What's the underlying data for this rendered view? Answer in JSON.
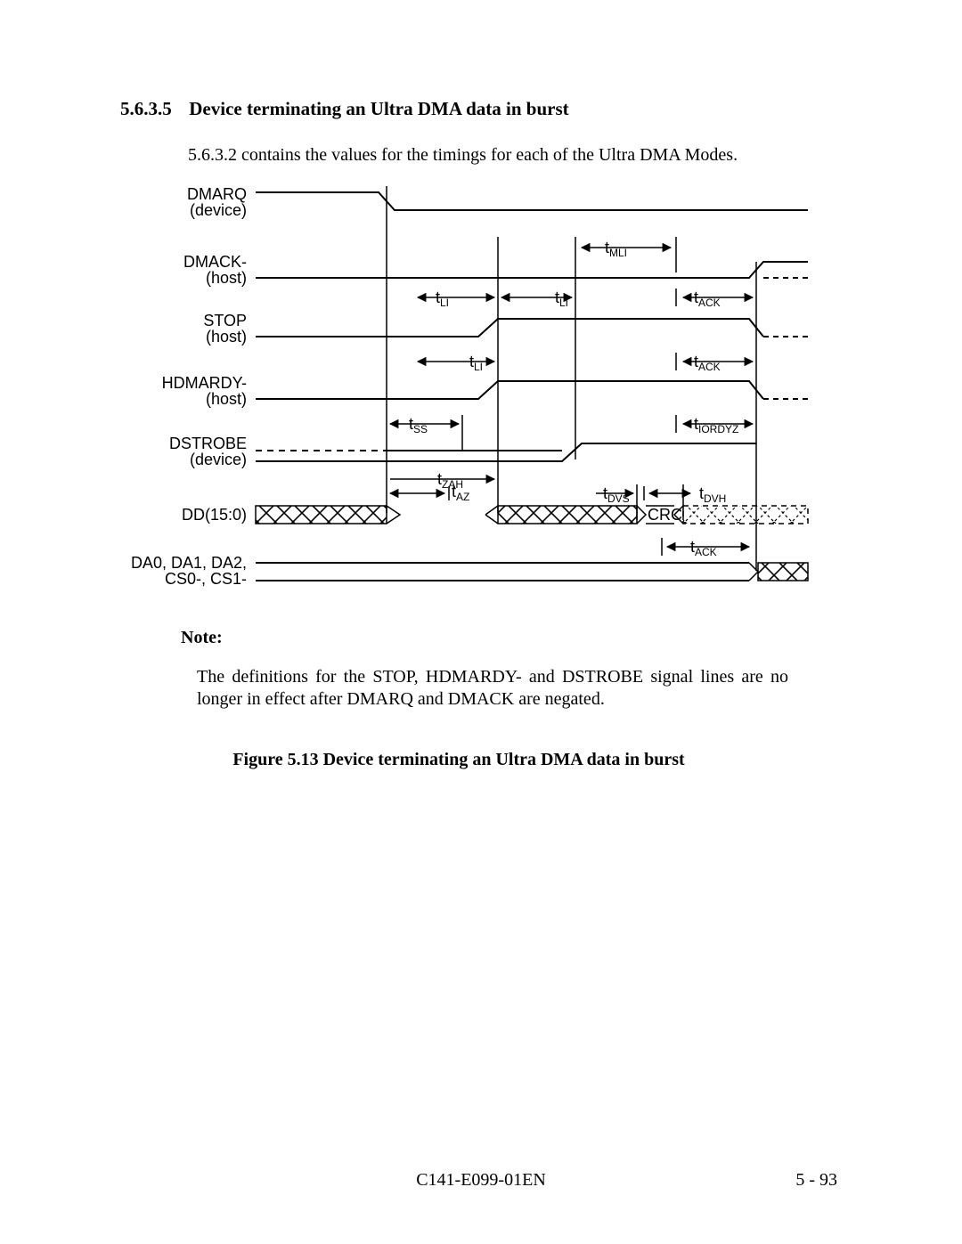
{
  "heading": {
    "number": "5.6.3.5",
    "title": "Device terminating an Ultra DMA data in burst"
  },
  "para1": "5.6.3.2 contains the values for the timings for each of the Ultra DMA Modes.",
  "signals": {
    "dmarq": {
      "name": "DMARQ",
      "role": "(device)"
    },
    "dmack": {
      "name": "DMACK-",
      "role": "(host)"
    },
    "stop": {
      "name": "STOP",
      "role": "(host)"
    },
    "hdmardy": {
      "name": "HDMARDY-",
      "role": "(host)"
    },
    "dstrobe": {
      "name": "DSTROBE",
      "role": "(device)"
    },
    "dd": {
      "name": "DD(15:0)"
    },
    "addr": {
      "line1": "DA0, DA1, DA2,",
      "line2": "CS0-, CS1-"
    }
  },
  "timings": {
    "tMLI": "MLI",
    "tLI": "LI",
    "tACK": "ACK",
    "tSS": "SS",
    "tIORDYZ": "IORDYZ",
    "tZAH": "ZAH",
    "tAZ": "AZ",
    "tDVS": "DVS",
    "tDVH": "DVH"
  },
  "crc": "CRC",
  "note": {
    "label": "Note:",
    "body": "The definitions for the STOP, HDMARDY- and DSTROBE signal lines are no longer in effect after DMARQ and DMACK are negated."
  },
  "figure": {
    "caption": "Figure 5.13  Device terminating an Ultra DMA data in burst"
  },
  "footer": {
    "center": "C141-E099-01EN",
    "right": "5 - 93"
  },
  "chart_data": {
    "type": "timing-diagram",
    "title": "Device terminating an Ultra DMA data in burst",
    "vlines_x": [
      305,
      430,
      517,
      630,
      720
    ],
    "signals": [
      {
        "name": "DMARQ",
        "source": "device",
        "trace": "high→edge@305→low"
      },
      {
        "name": "DMACK-",
        "source": "host",
        "trace": "low→edge@720→high(dashed after)"
      },
      {
        "name": "STOP",
        "source": "host",
        "trace": "low→edge@430→high→edge@720→low(dashed after)"
      },
      {
        "name": "HDMARDY-",
        "source": "host",
        "trace": "low→edge@430→high→edge@720→low(dashed after)"
      },
      {
        "name": "DSTROBE",
        "source": "device",
        "trace": "low(valid after 305)→edge@517→high→edge@720→tristate"
      },
      {
        "name": "DD(15:0)",
        "trace": "invalid→Z(305–430)→invalid(430–586)→CRC(586–638)→invalid(dashed)"
      },
      {
        "name": "DA0,DA1,DA2,CS0-,CS1-",
        "trace": "valid→edge@720→invalid"
      }
    ],
    "intervals": [
      {
        "label": "tMLI",
        "from": 517,
        "to": 630,
        "lane": "DMACK-"
      },
      {
        "label": "tLI",
        "from": 340,
        "to": 430,
        "lane": "STOP"
      },
      {
        "label": "tLI",
        "from": 430,
        "to": 517,
        "lane": "STOP"
      },
      {
        "label": "tACK",
        "from": 638,
        "to": 720,
        "lane": "STOP"
      },
      {
        "label": "tLI",
        "from": 340,
        "to": 430,
        "lane": "HDMARDY-"
      },
      {
        "label": "tACK",
        "from": 638,
        "to": 720,
        "lane": "HDMARDY-"
      },
      {
        "label": "tSS",
        "from": 305,
        "to": 390,
        "lane": "DSTROBE"
      },
      {
        "label": "tIORDYZ",
        "from": 638,
        "to": 720,
        "lane": "DSTROBE"
      },
      {
        "label": "tZAH",
        "from": 305,
        "to": 430,
        "lane": "DD"
      },
      {
        "label": "tAZ",
        "from": 305,
        "to": 370,
        "lane": "DD"
      },
      {
        "label": "tDVS",
        "from": 540,
        "to": 586,
        "lane": "DD"
      },
      {
        "label": "tDVH",
        "from": 600,
        "to": 650,
        "lane": "DD"
      },
      {
        "label": "tACK",
        "from": 620,
        "to": 712,
        "lane": "ADDR"
      }
    ]
  }
}
